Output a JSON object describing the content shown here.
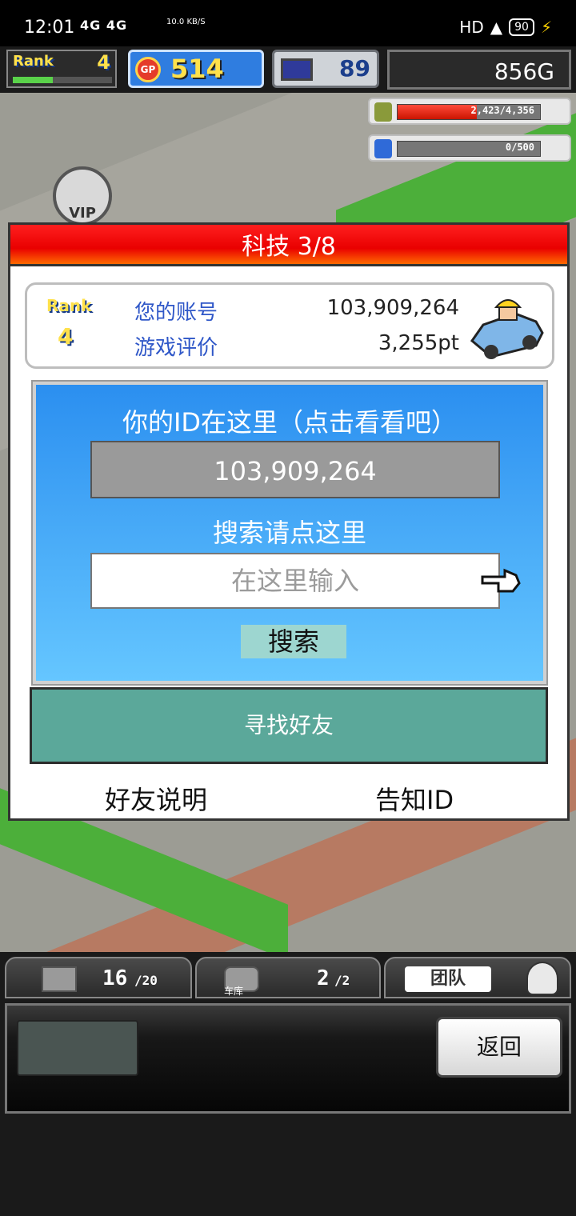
{
  "statusbar": {
    "time": "12:01",
    "signal": "4G 4G",
    "net_speed": "10.0 KB/S",
    "hd": "HD",
    "battery": "90"
  },
  "hud": {
    "rank_label": "Rank",
    "rank_value": "4",
    "rank_progress": 0.4,
    "gp_icon_text": "GP",
    "gp_value": "514",
    "pc_value": "89",
    "gold": "856G",
    "coins_meter": {
      "text": "2,423/4,356",
      "fraction": 0.556
    },
    "potion_meter": {
      "text": "0/500",
      "fraction": 0.0
    },
    "vip_label": "VIP"
  },
  "dialog": {
    "title": "科技 3/8",
    "rank_label": "Rank",
    "rank_value": "4",
    "account_label": "您的账号",
    "account_value": "103,909,264",
    "rating_label": "游戏评价",
    "rating_value": "3,255pt",
    "id_title": "你的ID在这里（点击看看吧）",
    "id_value": "103,909,264",
    "search_title": "搜索请点这里",
    "search_placeholder": "在这里输入",
    "search_button": "搜索",
    "find_friend": "寻找好友",
    "friend_help": "好友说明",
    "share_id": "告知ID"
  },
  "bottom": {
    "tab1_count": "16",
    "tab1_total": "/20",
    "tab2_label": "车库",
    "tab2_count": "2",
    "tab2_total": "/2",
    "tab3_label": "团队",
    "back": "返回"
  },
  "colors": {
    "title_red": "#ff1f1f",
    "panel_blue": "#2b8ff0",
    "friend_green": "#5ba89a",
    "rank_yellow": "#ffe14b"
  }
}
